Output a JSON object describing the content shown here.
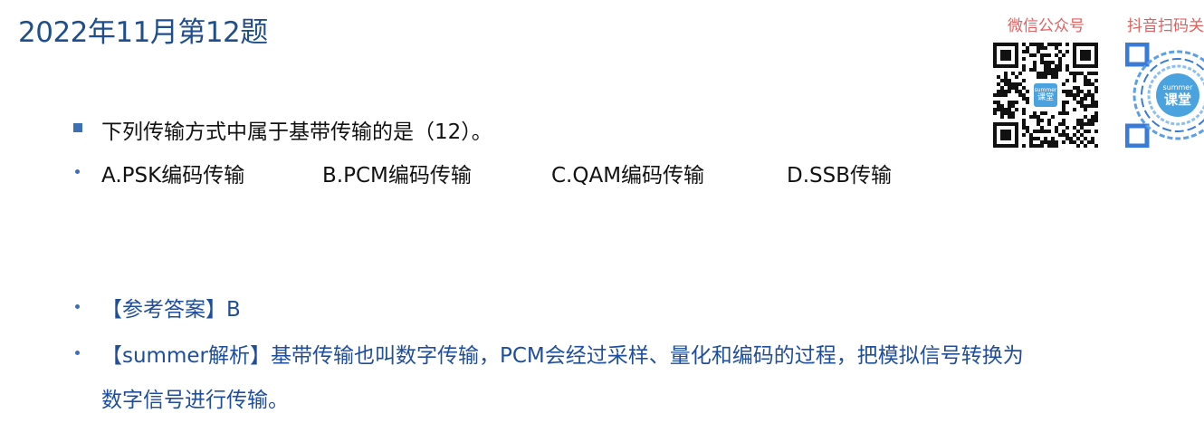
{
  "header": {
    "title": "2022年11月第12题"
  },
  "qr": {
    "wechat_label": "微信公众号",
    "douyin_label": "抖音扫码关",
    "logo_top": "summer",
    "logo_bottom": "课堂"
  },
  "question": {
    "stem": "下列传输方式中属于基带传输的是（12）。",
    "options": [
      "A.PSK编码传输",
      "B.PCM编码传输",
      "C.QAM编码传输",
      "D.SSB传输"
    ]
  },
  "answer": {
    "line": "【参考答案】B",
    "analysis_line1": "【summer解析】基带传输也叫数字传输，PCM会经过采样、量化和编码的过程，把模拟信号转换为",
    "analysis_line2": "数字信号进行传输。"
  },
  "colors": {
    "title": "#1f4e8c",
    "answer": "#1f4e9c",
    "bullet": "#3d6fb6",
    "qr_label": "#e06060"
  }
}
